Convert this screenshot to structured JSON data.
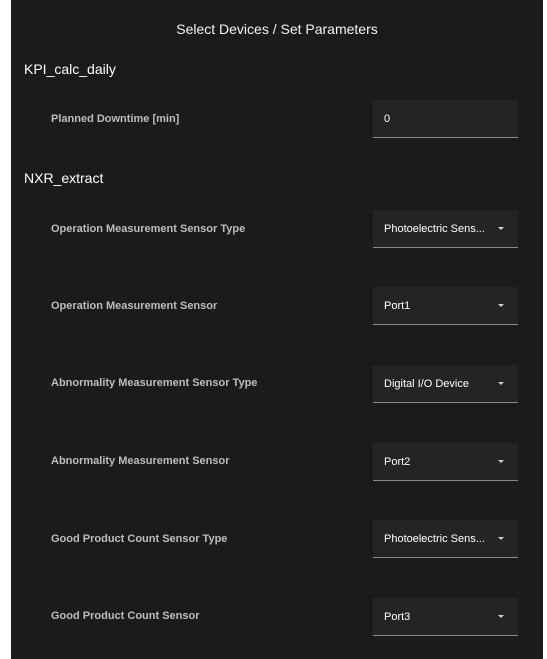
{
  "dialog": {
    "title": "Select Devices / Set Parameters"
  },
  "sections": [
    {
      "title": "KPI_calc_daily",
      "params": [
        {
          "label": "Planned Downtime [min]",
          "value": "0",
          "kind": "text-input"
        }
      ]
    },
    {
      "title": "NXR_extract",
      "params": [
        {
          "label": "Operation Measurement Sensor Type",
          "value": "Photoelectric Sens...",
          "kind": "select"
        },
        {
          "label": "Operation Measurement Sensor",
          "value": "Port1",
          "kind": "select"
        },
        {
          "label": "Abnormality Measurement Sensor Type",
          "value": "Digital I/O Device",
          "kind": "select"
        },
        {
          "label": "Abnormality Measurement Sensor",
          "value": "Port2",
          "kind": "select"
        },
        {
          "label": "Good Product Count Sensor Type",
          "value": "Photoelectric Sens...",
          "kind": "select"
        },
        {
          "label": "Good Product Count Sensor",
          "value": "Port3",
          "kind": "select"
        }
      ]
    }
  ],
  "icons": {
    "dropdown": "caret-down-icon"
  },
  "colors": {
    "panel_background": "#1b1b1b",
    "field_background": "#242424",
    "field_underline": "#8a8a8a",
    "label_text": "#bdbdbd",
    "value_text": "#ffffff"
  }
}
